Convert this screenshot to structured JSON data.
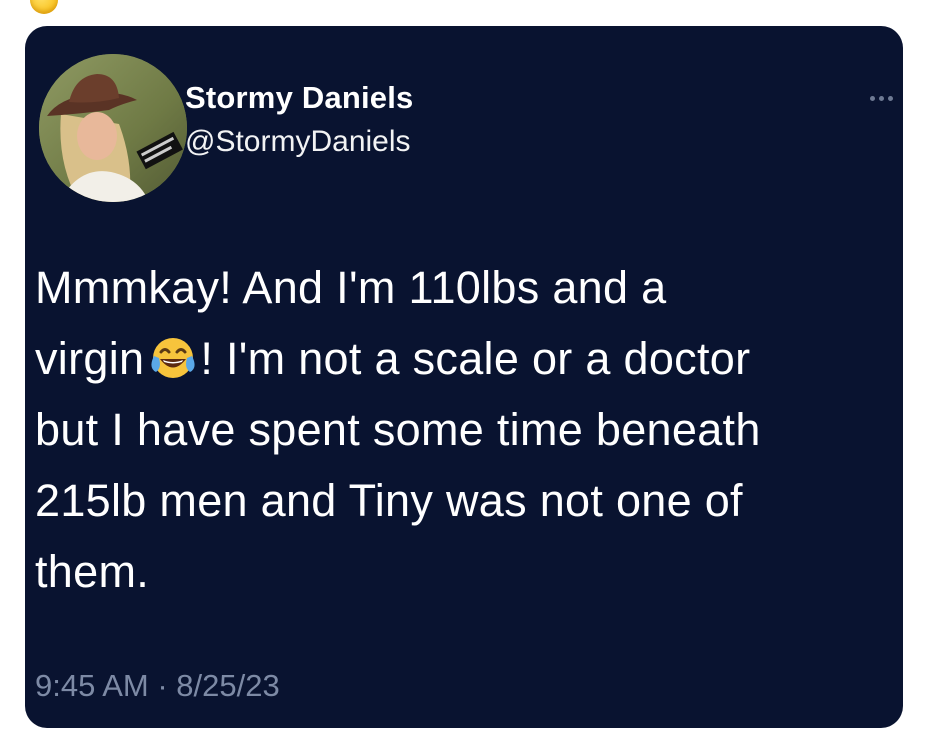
{
  "tweet": {
    "author": {
      "display_name": "Stormy Daniels",
      "handle": "@StormyDaniels"
    },
    "text": {
      "line1": "Mmmkay! And I'm 110lbs and a",
      "line2_before_emoji": "virgin",
      "emoji": "face-with-tears-of-joy-emoji",
      "line2_after_emoji": "! I'm not a scale or a doctor",
      "line3": "but I have spent some time beneath",
      "line4": "215lb men and Tiny was not one of",
      "line5": "them."
    },
    "timestamp": "9:45 AM · 8/25/23",
    "more_icon": "more-horizontal-icon"
  },
  "colors": {
    "card_background": "#091330",
    "text_primary": "#ffffff",
    "text_secondary": "#7d8aa5"
  }
}
